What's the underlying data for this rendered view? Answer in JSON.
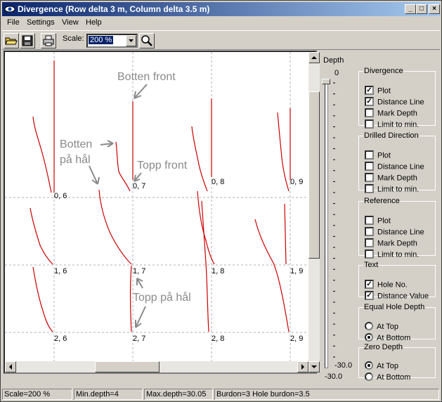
{
  "window": {
    "title": "Divergence (Row delta 3 m, Column delta 3.5 m)"
  },
  "title_buttons": {
    "minimize": "_",
    "maximize": "□",
    "close": "×"
  },
  "menu": [
    "File",
    "Settings",
    "View",
    "Help"
  ],
  "toolbar": {
    "scale_label": "Scale:",
    "scale_value": "200 %"
  },
  "plot": {
    "hole_labels": [
      "0, 6",
      "0, 7",
      "0, 8",
      "0, 9",
      "1, 6",
      "1, 7",
      "1, 8",
      "1, 9",
      "2, 6",
      "2, 7",
      "2, 8",
      "2, 9"
    ],
    "annotations": [
      "Botten front",
      "Botten",
      "på hål",
      "Topp front",
      "Topp på hål"
    ],
    "line_color": "#cc0000",
    "grid_color": "#b0b0b0",
    "annotation_color": "#8a8a8a"
  },
  "depth_slider": {
    "title": "Depth",
    "min_label": "0",
    "max_label": "-30.0",
    "max_label_bottom": "-30.0"
  },
  "groups": [
    {
      "title": "Divergence",
      "options": [
        {
          "label": "Plot",
          "checked": true
        },
        {
          "label": "Distance Line",
          "checked": true
        },
        {
          "label": "Mark Depth",
          "checked": false
        },
        {
          "label": "Limit to min.",
          "checked": false
        }
      ]
    },
    {
      "title": "Drilled Direction",
      "options": [
        {
          "label": "Plot",
          "checked": false
        },
        {
          "label": "Distance Line",
          "checked": false
        },
        {
          "label": "Mark Depth",
          "checked": false
        },
        {
          "label": "Limit to min.",
          "checked": false
        }
      ]
    },
    {
      "title": "Reference",
      "options": [
        {
          "label": "Plot",
          "checked": false
        },
        {
          "label": "Distance Line",
          "checked": false
        },
        {
          "label": "Mark Depth",
          "checked": false
        },
        {
          "label": "Limit to min.",
          "checked": false
        }
      ]
    },
    {
      "title": "Text",
      "options": [
        {
          "label": "Hole No.",
          "checked": true
        },
        {
          "label": "Distance Value",
          "checked": true
        }
      ]
    },
    {
      "title": "Equal Hole Depth",
      "radios": [
        {
          "label": "At Top",
          "selected": false
        },
        {
          "label": "At Bottom",
          "selected": true
        }
      ]
    },
    {
      "title": "Zero Depth",
      "radios": [
        {
          "label": "At Top",
          "selected": true
        },
        {
          "label": "At Bottom",
          "selected": false
        }
      ]
    }
  ],
  "status": {
    "scale": "Scale=200 %",
    "min_depth": "Min.depth=4",
    "max_depth": "Max.depth=30.05",
    "burdon": "Burdon=3 Hole burdon=3.5"
  }
}
